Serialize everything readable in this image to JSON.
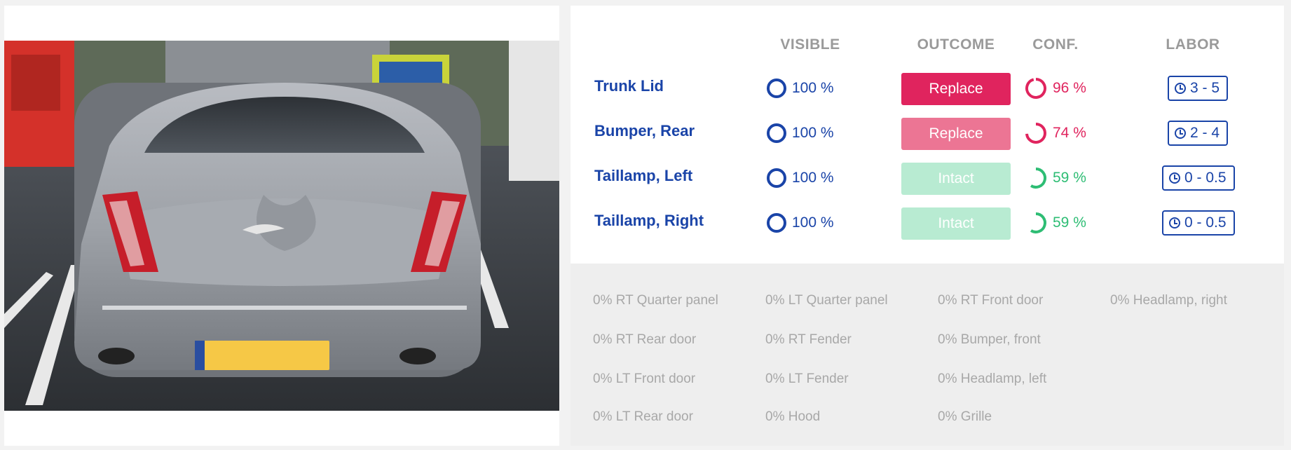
{
  "columns": {
    "visible": "VISIBLE",
    "outcome": "OUTCOME",
    "conf": "CONF.",
    "labor": "LABOR"
  },
  "rows": [
    {
      "part": "Trunk Lid",
      "visible": "100 %",
      "outcome": "Replace",
      "outcome_color": "#e0245e",
      "conf": "96 %",
      "conf_value": 0.96,
      "conf_color": "#e0245e",
      "labor": "3 - 5"
    },
    {
      "part": "Bumper, Rear",
      "visible": "100 %",
      "outcome": "Replace",
      "outcome_color": "#ec7594",
      "conf": "74 %",
      "conf_value": 0.74,
      "conf_color": "#e0245e",
      "labor": "2 - 4"
    },
    {
      "part": "Taillamp, Left",
      "visible": "100 %",
      "outcome": "Intact",
      "outcome_color": "#b8ebd2",
      "conf": "59 %",
      "conf_value": 0.59,
      "conf_color": "#2ebd74",
      "labor": "0 - 0.5"
    },
    {
      "part": "Taillamp, Right",
      "visible": "100 %",
      "outcome": "Intact",
      "outcome_color": "#b8ebd2",
      "conf": "59 %",
      "conf_value": 0.59,
      "conf_color": "#2ebd74",
      "labor": "0 - 0.5"
    }
  ],
  "other_parts": [
    [
      "0% RT Quarter panel",
      "0% LT Quarter panel",
      "0% RT Front door",
      "0% Headlamp, right"
    ],
    [
      "0% RT Rear door",
      "0% RT Fender",
      "0% Bumper, front"
    ],
    [
      "0% LT Front door",
      "0% LT Fender",
      "0% Headlamp, left"
    ],
    [
      "0% LT Rear door",
      "0% Hood",
      "0% Grille"
    ]
  ],
  "colors": {
    "accent_blue": "#1a44a8",
    "replace_red": "#e0245e",
    "intact_green": "#2ebd74"
  }
}
